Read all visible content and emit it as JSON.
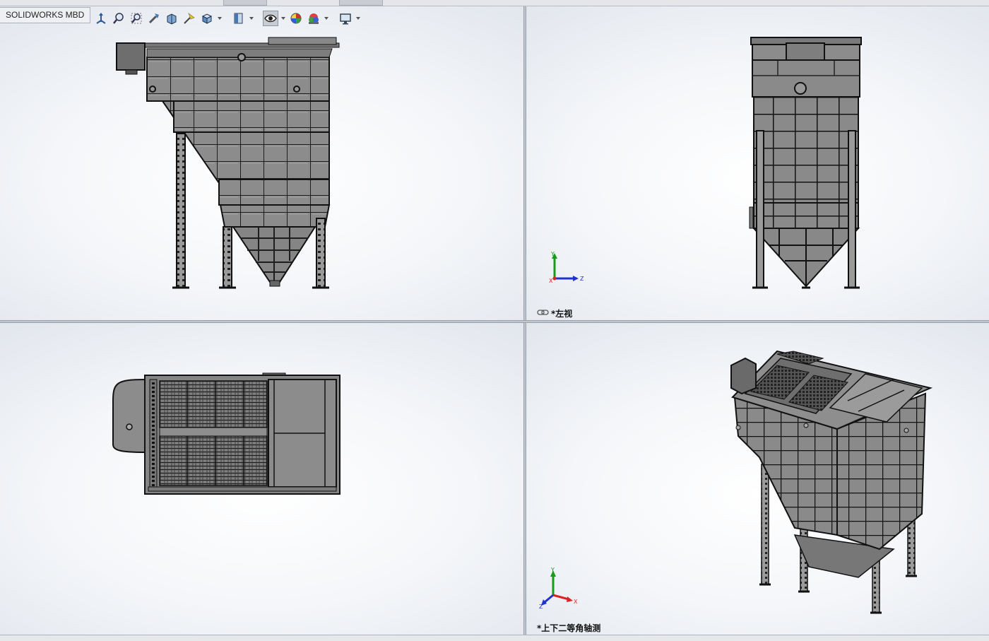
{
  "app": {
    "tab_label": "SOLIDWORKS MBD"
  },
  "toolbar": {
    "buttons": [
      {
        "icon": "view-orientation-icon"
      },
      {
        "icon": "zoom-to-fit-icon"
      },
      {
        "icon": "zoom-to-area-icon"
      },
      {
        "icon": "previous-view-icon"
      },
      {
        "icon": "section-view-icon"
      },
      {
        "icon": "dynamic-annotation-icon"
      },
      {
        "icon": "view-orientation-cube-icon"
      },
      {
        "icon": "display-style-icon"
      },
      {
        "icon": "hide-show-items-icon"
      },
      {
        "icon": "edit-appearance-icon"
      },
      {
        "icon": "apply-scene-icon"
      },
      {
        "icon": "view-settings-icon"
      }
    ]
  },
  "viewports": {
    "top_left": {
      "label": ""
    },
    "top_right": {
      "label": "*左视",
      "link_icon": "link-views-icon"
    },
    "bottom_left": {
      "label": ""
    },
    "bottom_right": {
      "label": "*上下二等角轴测"
    }
  },
  "triad": {
    "x": "X",
    "y": "Y",
    "z": "Z"
  },
  "colors": {
    "model_gray": "#8a8a8a",
    "axis_x": "#d22",
    "axis_y": "#1a9a1a",
    "axis_z": "#2233cc"
  }
}
